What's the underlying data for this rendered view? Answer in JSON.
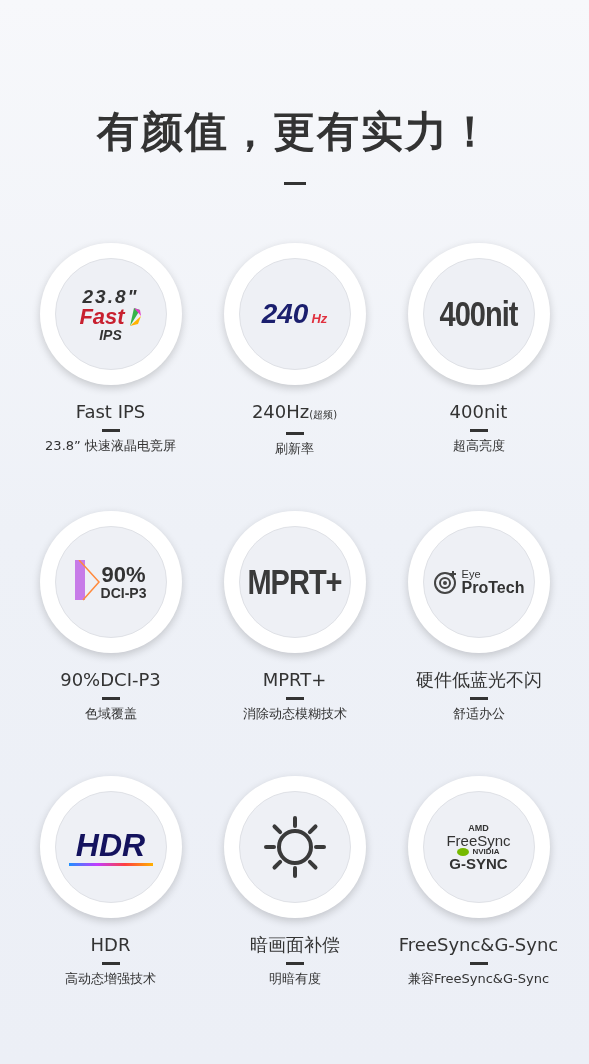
{
  "heading": "有颜值，更有实力！",
  "features": [
    {
      "badge": {
        "kind": "fast-ips",
        "lines": [
          "23.8\"",
          "Fast",
          "IPS"
        ]
      },
      "title": "Fast IPS",
      "subtitle": "23.8” 快速液晶电竞屏"
    },
    {
      "badge": {
        "kind": "hz",
        "lines": [
          "240",
          "Hz"
        ]
      },
      "title": "240Hz",
      "title_note": "(超频)",
      "subtitle": "刷新率"
    },
    {
      "badge": {
        "kind": "plain",
        "lines": [
          "400nit"
        ]
      },
      "title": "400nit",
      "subtitle": "超高亮度"
    },
    {
      "badge": {
        "kind": "gamut",
        "lines": [
          "90%",
          "DCI-P3"
        ]
      },
      "title": "90%DCI-P3",
      "subtitle": "色域覆盖"
    },
    {
      "badge": {
        "kind": "plain",
        "lines": [
          "MPRT+"
        ]
      },
      "title": "MPRT+",
      "subtitle": "消除动态模糊技术"
    },
    {
      "badge": {
        "kind": "eye",
        "lines": [
          "Eye",
          "ProTech"
        ]
      },
      "title": "硬件低蓝光不闪",
      "subtitle": "舒适办公"
    },
    {
      "badge": {
        "kind": "hdr",
        "lines": [
          "HDR"
        ]
      },
      "title": "HDR",
      "subtitle": "高动态增强技术"
    },
    {
      "badge": {
        "kind": "sun"
      },
      "title": "暗画面补偿",
      "subtitle": "明暗有度"
    },
    {
      "badge": {
        "kind": "sync",
        "lines": [
          "AMD",
          "FreeSync",
          "NVIDIA",
          "G-SYNC"
        ]
      },
      "title": "FreeSync&G-Sync",
      "subtitle": "兼容FreeSync&G-Sync"
    }
  ]
}
